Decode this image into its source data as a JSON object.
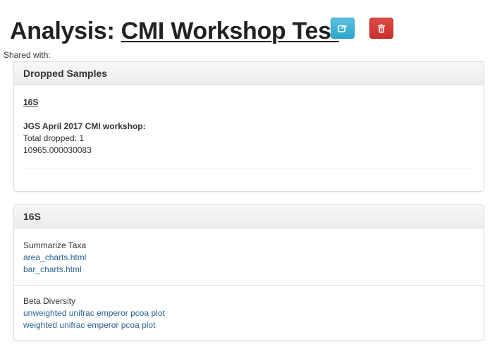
{
  "header": {
    "title_prefix": "Analysis: ",
    "title_link": "CMI Workshop Test",
    "share_icon": "share-icon",
    "delete_icon": "trash-icon",
    "shared_with_label": "Shared with:"
  },
  "dropped_samples": {
    "heading": "Dropped Samples",
    "group": "16S",
    "study": "JGS April 2017 CMI workshop:",
    "total_dropped": "Total dropped: 1",
    "samples": [
      "10965.000030083"
    ]
  },
  "results_panel": {
    "heading": "16S",
    "sections": [
      {
        "title": "Summarize Taxa",
        "links": [
          "area_charts.html",
          "bar_charts.html"
        ]
      },
      {
        "title": "Beta Diversity",
        "links": [
          "unweighted unifrac emperor pcoa plot",
          "weighted unifrac emperor pcoa plot"
        ]
      }
    ]
  },
  "colors": {
    "share_button": "#31b0d5",
    "delete_button": "#d2322d",
    "link": "#2a6496"
  }
}
